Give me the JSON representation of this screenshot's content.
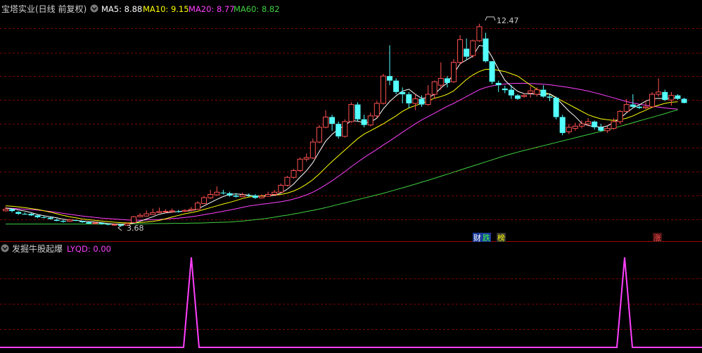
{
  "main_panel": {
    "title": "宝塔实业(日线 前复权)",
    "ma_labels": [
      {
        "key": "MA5",
        "text": "MA5: 8.88",
        "color": "#ffffff"
      },
      {
        "key": "MA10",
        "text": "MA10: 9.15",
        "color": "#ffff00"
      },
      {
        "key": "MA20",
        "text": "MA20: 8.77",
        "color": "#ff40ff"
      },
      {
        "key": "MA60",
        "text": "MA60: 8.82",
        "color": "#40d040"
      }
    ],
    "high_label": "12.47",
    "low_label": "3.68",
    "event_tags": [
      {
        "text": "财",
        "bg": "#1a3a9a",
        "fg": "#ffffff"
      },
      {
        "text": "跌",
        "bg": "#1a3a9a",
        "fg": "#40ff40"
      },
      {
        "text": "榜",
        "bg": "#333333",
        "fg": "#ffff00"
      },
      {
        "text": "涨",
        "bg": "#4a1010",
        "fg": "#ff5050"
      }
    ]
  },
  "indicator_panel": {
    "title": "发掘牛股起爆",
    "value_label": "LYQD: 0.00",
    "value_color": "#ff40ff"
  },
  "colors": {
    "up": "#ff5050",
    "down": "#54ffff",
    "grid": "#7a0000",
    "ma5": "#ffffff",
    "ma10": "#ffff00",
    "ma20": "#ff40ff",
    "ma60": "#40d040",
    "indicator": "#ff40ff"
  },
  "chart_data": {
    "type": "candlestick",
    "y_range": [
      3.2,
      12.9
    ],
    "candles": [
      [
        4.38,
        4.45,
        4.55,
        4.35
      ],
      [
        4.45,
        4.37,
        4.48,
        4.31
      ],
      [
        4.33,
        4.25,
        4.36,
        4.2
      ],
      [
        4.25,
        4.24,
        4.31,
        4.21
      ],
      [
        4.25,
        4.18,
        4.28,
        4.15
      ],
      [
        4.18,
        4.1,
        4.21,
        4.06
      ],
      [
        4.1,
        4.08,
        4.15,
        4.05
      ],
      [
        4.08,
        4.02,
        4.11,
        3.99
      ],
      [
        3.99,
        3.94,
        4.04,
        3.92
      ],
      [
        3.94,
        3.9,
        3.98,
        3.86
      ],
      [
        3.92,
        3.98,
        4.03,
        3.9
      ],
      [
        3.97,
        3.95,
        4.0,
        3.93
      ],
      [
        3.93,
        3.88,
        3.95,
        3.85
      ],
      [
        3.88,
        3.82,
        3.91,
        3.8
      ],
      [
        3.82,
        3.85,
        3.9,
        3.79
      ],
      [
        3.85,
        3.8,
        3.87,
        3.77
      ],
      [
        3.8,
        3.77,
        3.83,
        3.74
      ],
      [
        3.76,
        3.78,
        3.82,
        3.73
      ],
      [
        3.77,
        3.72,
        3.8,
        3.68
      ],
      [
        3.75,
        3.82,
        3.86,
        3.73
      ],
      [
        3.86,
        4.12,
        4.16,
        3.85
      ],
      [
        4.12,
        4.18,
        4.28,
        4.1
      ],
      [
        4.15,
        4.25,
        4.4,
        4.13
      ],
      [
        4.22,
        4.3,
        4.48,
        4.2
      ],
      [
        4.3,
        4.35,
        4.52,
        4.28
      ],
      [
        4.33,
        4.36,
        4.45,
        4.28
      ],
      [
        4.34,
        4.38,
        4.48,
        4.3
      ],
      [
        4.36,
        4.35,
        4.42,
        4.3
      ],
      [
        4.36,
        4.4,
        4.45,
        4.32
      ],
      [
        4.4,
        4.45,
        4.55,
        4.38
      ],
      [
        4.45,
        4.72,
        4.8,
        4.42
      ],
      [
        4.7,
        4.96,
        5.02,
        4.68
      ],
      [
        4.95,
        5.1,
        5.3,
        4.9
      ],
      [
        5.08,
        5.2,
        5.45,
        5.05
      ],
      [
        5.18,
        5.15,
        5.3,
        5.1
      ],
      [
        5.15,
        5.05,
        5.22,
        5.0
      ],
      [
        5.05,
        5.0,
        5.15,
        4.96
      ],
      [
        5.0,
        5.08,
        5.18,
        4.98
      ],
      [
        5.06,
        5.05,
        5.15,
        5.0
      ],
      [
        5.05,
        4.95,
        5.12,
        4.9
      ],
      [
        4.95,
        5.02,
        5.1,
        4.92
      ],
      [
        5.02,
        5.1,
        5.22,
        5.0
      ],
      [
        5.1,
        5.2,
        5.3,
        5.06
      ],
      [
        5.2,
        5.5,
        5.58,
        5.18
      ],
      [
        5.5,
        5.85,
        5.92,
        5.45
      ],
      [
        5.85,
        6.15,
        6.22,
        5.8
      ],
      [
        6.15,
        6.65,
        6.72,
        6.1
      ],
      [
        6.65,
        6.72,
        6.9,
        6.55
      ],
      [
        6.7,
        7.4,
        7.55,
        6.65
      ],
      [
        7.4,
        8.05,
        8.15,
        7.35
      ],
      [
        8.05,
        8.5,
        8.8,
        8.0
      ],
      [
        8.5,
        8.2,
        8.6,
        7.9
      ],
      [
        8.2,
        7.65,
        8.3,
        7.55
      ],
      [
        7.65,
        8.3,
        8.4,
        7.6
      ],
      [
        8.3,
        9.05,
        9.15,
        8.25
      ],
      [
        9.05,
        8.4,
        9.15,
        8.3
      ],
      [
        8.4,
        8.15,
        8.6,
        8.05
      ],
      [
        8.15,
        8.55,
        8.7,
        8.1
      ],
      [
        8.55,
        9.1,
        9.2,
        8.45
      ],
      [
        9.1,
        10.3,
        10.4,
        9.05
      ],
      [
        10.3,
        10.1,
        11.65,
        9.9
      ],
      [
        10.1,
        9.6,
        10.2,
        9.5
      ],
      [
        9.6,
        9.5,
        9.8,
        9.1
      ],
      [
        9.5,
        9.1,
        9.6,
        8.9
      ],
      [
        9.1,
        9.3,
        9.5,
        8.8
      ],
      [
        9.3,
        9.05,
        9.45,
        8.95
      ],
      [
        9.05,
        9.5,
        9.9,
        9.0
      ],
      [
        9.5,
        10.05,
        10.1,
        9.3
      ],
      [
        9.9,
        10.2,
        10.9,
        9.7
      ],
      [
        10.2,
        10.0,
        10.3,
        9.8
      ],
      [
        10.05,
        10.9,
        11.05,
        10.0
      ],
      [
        10.9,
        11.9,
        12.1,
        10.8
      ],
      [
        11.5,
        11.15,
        11.95,
        11.0
      ],
      [
        11.2,
        11.85,
        11.9,
        11.1
      ],
      [
        11.85,
        12.47,
        12.6,
        11.8
      ],
      [
        11.95,
        10.95,
        12.2,
        10.9
      ],
      [
        10.95,
        10.05,
        10.4,
        9.95
      ],
      [
        10.0,
        9.9,
        10.1,
        9.6
      ],
      [
        9.75,
        9.68,
        9.88,
        9.55
      ],
      [
        9.7,
        9.45,
        9.9,
        9.3
      ],
      [
        9.45,
        9.3,
        9.5,
        9.25
      ],
      [
        9.4,
        9.45,
        9.55,
        9.35
      ],
      [
        9.55,
        9.65,
        9.85,
        9.35
      ],
      [
        9.5,
        9.7,
        9.8,
        9.4
      ],
      [
        9.7,
        9.4,
        9.9,
        9.35
      ],
      [
        9.4,
        9.35,
        9.5,
        9.2
      ],
      [
        9.35,
        8.5,
        9.4,
        8.4
      ],
      [
        8.5,
        7.8,
        8.6,
        7.7
      ],
      [
        7.85,
        8.05,
        8.2,
        7.75
      ],
      [
        8.0,
        8.1,
        8.25,
        7.9
      ],
      [
        8.1,
        8.2,
        8.35,
        8.0
      ],
      [
        8.2,
        8.3,
        8.45,
        8.1
      ],
      [
        8.3,
        8.05,
        8.35,
        7.95
      ],
      [
        8.05,
        7.9,
        8.2,
        7.85
      ],
      [
        7.9,
        8.0,
        8.1,
        7.8
      ],
      [
        8.0,
        8.3,
        8.45,
        7.95
      ],
      [
        8.3,
        8.75,
        8.8,
        8.2
      ],
      [
        8.75,
        9.05,
        9.3,
        8.7
      ],
      [
        9.05,
        8.95,
        9.5,
        8.9
      ],
      [
        8.95,
        8.9,
        9.05,
        8.85
      ],
      [
        8.9,
        8.95,
        9.2,
        8.85
      ],
      [
        8.95,
        9.5,
        9.6,
        8.9
      ],
      [
        9.5,
        9.6,
        10.2,
        9.4
      ],
      [
        9.6,
        9.25,
        9.7,
        9.2
      ],
      [
        9.25,
        9.45,
        9.6,
        9.0
      ],
      [
        9.45,
        9.3,
        9.5,
        9.25
      ],
      [
        9.3,
        9.12,
        9.35,
        9.1
      ]
    ],
    "ma5": [
      4.5,
      4.47,
      4.42,
      4.37,
      4.3,
      4.22,
      4.16,
      4.12,
      4.07,
      4.01,
      3.98,
      3.96,
      3.93,
      3.91,
      3.89,
      3.86,
      3.82,
      3.8,
      3.79,
      3.78,
      3.84,
      3.92,
      4.02,
      4.12,
      4.23,
      4.29,
      4.32,
      4.35,
      4.37,
      4.38,
      4.46,
      4.6,
      4.74,
      4.88,
      5.01,
      5.1,
      5.12,
      5.1,
      5.07,
      5.03,
      5.01,
      5.04,
      5.06,
      5.16,
      5.33,
      5.56,
      5.86,
      6.14,
      6.5,
      6.98,
      7.44,
      7.74,
      7.96,
      8.13,
      8.34,
      8.32,
      8.24,
      8.28,
      8.45,
      8.86,
      9.18,
      9.43,
      9.64,
      9.72,
      9.5,
      9.32,
      9.35,
      9.5,
      9.78,
      10.0,
      10.4,
      10.84,
      11.01,
      11.18,
      11.65,
      11.6,
      11.13,
      10.6,
      10.11,
      9.85,
      9.63,
      9.53,
      9.52,
      9.5,
      9.48,
      9.52,
      9.36,
      9.05,
      8.76,
      8.52,
      8.22,
      8.13,
      8.08,
      8.05,
      8.11,
      8.26,
      8.44,
      8.69,
      8.9,
      9.04,
      9.2,
      9.3,
      9.32,
      9.31,
      9.33,
      9.34
    ],
    "ma10": [
      4.6,
      4.58,
      4.55,
      4.52,
      4.48,
      4.44,
      4.38,
      4.32,
      4.25,
      4.18,
      4.12,
      4.07,
      4.02,
      3.99,
      3.96,
      3.93,
      3.9,
      3.88,
      3.86,
      3.85,
      3.85,
      3.87,
      3.89,
      3.92,
      3.96,
      4.03,
      4.11,
      4.18,
      4.25,
      4.3,
      4.36,
      4.44,
      4.52,
      4.6,
      4.68,
      4.75,
      4.83,
      4.92,
      4.99,
      5.02,
      5.04,
      5.05,
      5.07,
      5.1,
      5.16,
      5.25,
      5.38,
      5.55,
      5.75,
      6.0,
      6.28,
      6.55,
      6.8,
      7.05,
      7.3,
      7.55,
      7.75,
      7.9,
      8.05,
      8.2,
      8.38,
      8.55,
      8.75,
      8.9,
      9.0,
      9.1,
      9.2,
      9.33,
      9.4,
      9.5,
      9.65,
      9.9,
      10.15,
      10.35,
      10.5,
      10.6,
      10.6,
      10.55,
      10.5,
      10.4,
      10.3,
      10.1,
      9.9,
      9.72,
      9.6,
      9.5,
      9.35,
      9.2,
      9.05,
      8.9,
      8.75,
      8.6,
      8.5,
      8.42,
      8.38,
      8.35,
      8.38,
      8.45,
      8.55,
      8.68,
      8.8,
      8.93,
      9.02,
      9.1,
      9.15,
      9.17
    ],
    "ma20": [
      4.5,
      4.49,
      4.47,
      4.45,
      4.43,
      4.41,
      4.38,
      4.35,
      4.31,
      4.27,
      4.23,
      4.19,
      4.15,
      4.12,
      4.09,
      4.06,
      4.04,
      4.02,
      4.0,
      3.98,
      3.97,
      3.97,
      3.98,
      3.99,
      4.0,
      4.02,
      4.04,
      4.06,
      4.09,
      4.12,
      4.16,
      4.21,
      4.26,
      4.31,
      4.36,
      4.41,
      4.47,
      4.53,
      4.59,
      4.63,
      4.67,
      4.7,
      4.74,
      4.78,
      4.83,
      4.9,
      4.98,
      5.08,
      5.2,
      5.35,
      5.52,
      5.7,
      5.9,
      6.1,
      6.32,
      6.52,
      6.72,
      6.9,
      7.08,
      7.27,
      7.45,
      7.64,
      7.83,
      8.02,
      8.2,
      8.37,
      8.52,
      8.67,
      8.82,
      8.97,
      9.1,
      9.25,
      9.4,
      9.55,
      9.7,
      9.8,
      9.87,
      9.92,
      9.95,
      9.97,
      9.98,
      9.98,
      9.97,
      9.96,
      9.94,
      9.92,
      9.88,
      9.84,
      9.8,
      9.75,
      9.7,
      9.64,
      9.57,
      9.5,
      9.42,
      9.34,
      9.26,
      9.18,
      9.12,
      9.06,
      9.02,
      8.98,
      8.94,
      8.9,
      8.87,
      8.85
    ],
    "ma60": [
      3.8,
      3.8,
      3.8,
      3.8,
      3.8,
      3.8,
      3.8,
      3.8,
      3.8,
      3.8,
      3.8,
      3.8,
      3.8,
      3.8,
      3.8,
      3.8,
      3.8,
      3.8,
      3.8,
      3.81,
      3.81,
      3.81,
      3.81,
      3.82,
      3.82,
      3.82,
      3.83,
      3.83,
      3.83,
      3.84,
      3.84,
      3.85,
      3.86,
      3.87,
      3.88,
      3.89,
      3.91,
      3.93,
      3.96,
      3.99,
      4.02,
      4.06,
      4.1,
      4.15,
      4.19,
      4.24,
      4.29,
      4.35,
      4.4,
      4.46,
      4.52,
      4.59,
      4.66,
      4.73,
      4.8,
      4.87,
      4.94,
      5.01,
      5.08,
      5.15,
      5.23,
      5.31,
      5.39,
      5.47,
      5.55,
      5.64,
      5.72,
      5.81,
      5.9,
      5.99,
      6.08,
      6.17,
      6.26,
      6.35,
      6.44,
      6.53,
      6.62,
      6.71,
      6.8,
      6.88,
      6.96,
      7.03,
      7.1,
      7.17,
      7.24,
      7.31,
      7.38,
      7.45,
      7.52,
      7.59,
      7.66,
      7.73,
      7.8,
      7.87,
      7.94,
      8.01,
      8.09,
      8.17,
      8.25,
      8.33,
      8.41,
      8.49,
      8.57,
      8.65,
      8.74,
      8.82
    ],
    "indicator": {
      "name": "LYQD",
      "y_range": [
        0,
        1
      ],
      "spikes_at_index": [
        22,
        107
      ],
      "baseline": 0
    }
  }
}
